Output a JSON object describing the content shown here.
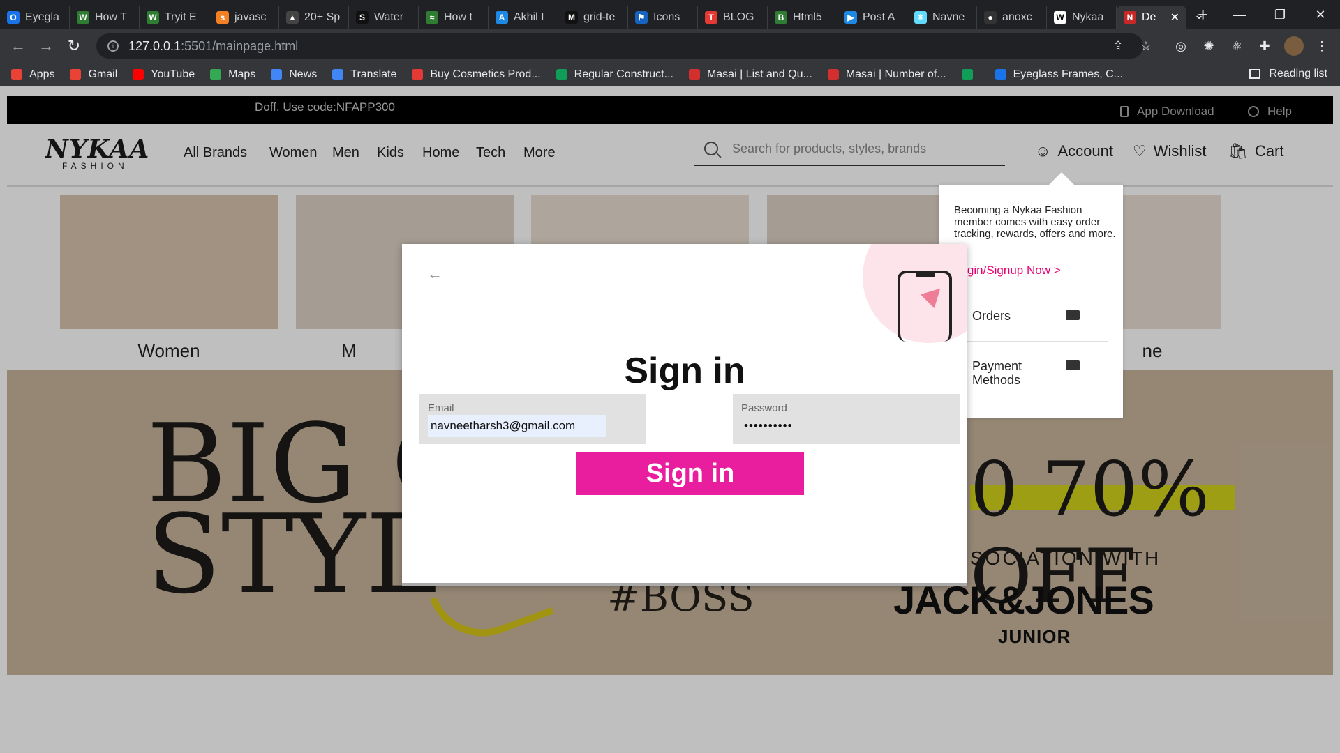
{
  "browser": {
    "tabs": [
      {
        "label": "Eyegla",
        "color": "#1a73e8",
        "glyph": "O"
      },
      {
        "label": "How T",
        "color": "#2e7d32",
        "glyph": "W"
      },
      {
        "label": "Tryit E",
        "color": "#2e7d32",
        "glyph": "W"
      },
      {
        "label": "javasc",
        "color": "#f48024",
        "glyph": "s"
      },
      {
        "label": "20+ Sp",
        "color": "#444444",
        "glyph": "▲"
      },
      {
        "label": "Water",
        "color": "#111111",
        "glyph": "S"
      },
      {
        "label": "How t",
        "color": "#2e7d32",
        "glyph": "≈"
      },
      {
        "label": "Akhil I",
        "color": "#1e88e5",
        "glyph": "A"
      },
      {
        "label": "grid-te",
        "color": "#111111",
        "glyph": "M"
      },
      {
        "label": "Icons",
        "color": "#1565c0",
        "glyph": "⚑"
      },
      {
        "label": "BLOG",
        "color": "#e53935",
        "glyph": "T"
      },
      {
        "label": "Html5",
        "color": "#2e7d32",
        "glyph": "B"
      },
      {
        "label": "Post A",
        "color": "#1e88e5",
        "glyph": "▶"
      },
      {
        "label": "Navne",
        "color": "#61dafb",
        "glyph": "⚛"
      },
      {
        "label": "anoxc",
        "color": "#333333",
        "glyph": "●"
      },
      {
        "label": "Nykaa",
        "color": "#ffffff",
        "glyph": "W"
      },
      {
        "label": "De",
        "color": "#c62828",
        "glyph": "N"
      }
    ],
    "new_tab": "+",
    "window_controls": {
      "dropdown": "⌄",
      "minimize": "—",
      "restore": "❐",
      "close": "✕"
    },
    "tab_close": "✕",
    "url_host": "127.0.0.1",
    "url_path": ":5501/mainpage.html",
    "nav": {
      "back": "←",
      "forward": "→",
      "reload": "↻"
    },
    "toolbar_icons": {
      "share": "⇪",
      "star": "☆",
      "ext1": "◎",
      "ext2": "✺",
      "react": "⚛",
      "puzzle": "✚",
      "menu": "⋮"
    },
    "bookmarks": [
      {
        "label": "Apps",
        "color": "#ea4335"
      },
      {
        "label": "Gmail",
        "color": "#ea4335"
      },
      {
        "label": "YouTube",
        "color": "#ff0000"
      },
      {
        "label": "Maps",
        "color": "#34a853"
      },
      {
        "label": "News",
        "color": "#4285f4"
      },
      {
        "label": "Translate",
        "color": "#4285f4"
      },
      {
        "label": "Buy Cosmetics Prod...",
        "color": "#e53935"
      },
      {
        "label": "Regular Construct...",
        "color": "#0f9d58"
      },
      {
        "label": "Masai | List and Qu...",
        "color": "#d32f2f"
      },
      {
        "label": "Masai | Number of...",
        "color": "#d32f2f"
      },
      {
        "label": "",
        "color": "#0f9d58"
      },
      {
        "label": "Eyeglass Frames, C...",
        "color": "#1a73e8"
      }
    ],
    "reading_list": "Reading list"
  },
  "site": {
    "promo_code": "Doff. Use code:NFAPP300",
    "app_download": "App Download",
    "help": "Help",
    "logo_top": "NYKAA",
    "logo_bottom": "FASHION",
    "nav_links": [
      "All Brands",
      "Women",
      "Men",
      "Kids",
      "Home",
      "Tech",
      "More"
    ],
    "search_placeholder": "Search for products, styles, brands",
    "account": "Account",
    "wishlist": "Wishlist",
    "cart": "Cart",
    "icons": {
      "account": "☺",
      "wishlist": "♡",
      "cart": "🛍"
    },
    "categories": [
      {
        "label": "Women",
        "color": "#d9c3ae"
      },
      {
        "label": "M",
        "color": "#ddd0c4"
      },
      {
        "label": "",
        "color": "#e8ddd0"
      },
      {
        "label": "",
        "color": "#ddd0c4"
      },
      {
        "label": "ne",
        "color": "#e7ddd3"
      }
    ],
    "banner": {
      "big_line1": "BIG O",
      "big_line2": "STYL",
      "boss": "#BOSS",
      "off": "0 70% OFF",
      "association": "SOCIATION WITH",
      "brand": "JACK&JONES",
      "junior": "JUNIOR"
    }
  },
  "account_menu": {
    "description": "Becoming a Nykaa Fashion member comes with easy order tracking, rewards, offers and more.",
    "login": "Login/Signup Now >",
    "items": [
      "Orders",
      "Payment Methods"
    ]
  },
  "modal": {
    "back": "←",
    "title": "Sign in",
    "email_label": "Email",
    "email_value": "navneetharsh3@gmail.com",
    "password_label": "Password",
    "password_value": "••••••••••",
    "submit": "Sign in"
  }
}
